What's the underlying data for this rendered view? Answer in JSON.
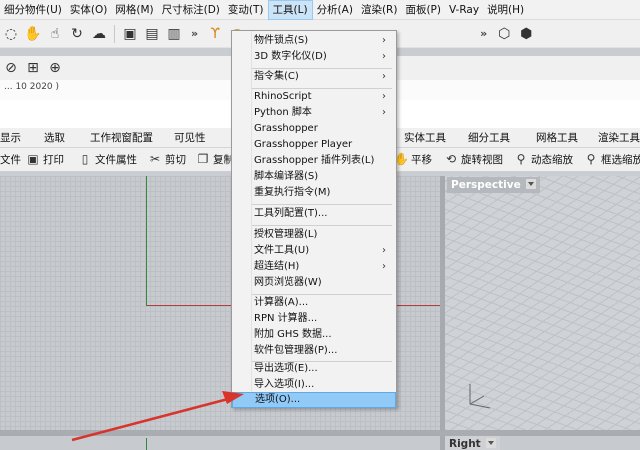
{
  "menubar": {
    "items": [
      "细分物件(U)",
      "实体(O)",
      "网格(M)",
      "尺寸标注(D)",
      "变动(T)",
      "工具(L)",
      "分析(A)",
      "渲染(R)",
      "面板(P)",
      "V-Ray",
      "说明(H)"
    ],
    "active": "工具(L)"
  },
  "command_line": "... 10 2020 )",
  "tabs": [
    "显示",
    "选取",
    "工作视窗配置",
    "可见性",
    "实体工具",
    "细分工具",
    "网格工具",
    "渲染工具"
  ],
  "std_toolbar": {
    "file": "文件",
    "print": "打印",
    "properties": "文件属性",
    "cut": "剪切",
    "copy": "复制",
    "pan": "平移",
    "rotate_view": "旋转视图",
    "dynamic_zoom": "动态缩放",
    "zoom_window": "框选缩放"
  },
  "viewports": {
    "perspective": "Perspective",
    "right": "Right"
  },
  "tools_menu": {
    "groups": [
      [
        {
          "label": "物件锁点(S)",
          "submenu": true
        },
        {
          "label": "3D 数字化仪(D)",
          "submenu": true
        }
      ],
      [
        {
          "label": "指令集(C)",
          "submenu": true
        }
      ],
      [
        {
          "label": "RhinoScript",
          "submenu": true
        },
        {
          "label": "Python 脚本",
          "submenu": true
        },
        {
          "label": "Grasshopper",
          "submenu": false
        },
        {
          "label": "Grasshopper Player",
          "submenu": false
        },
        {
          "label": "Grasshopper 插件列表(L)",
          "submenu": false
        },
        {
          "label": "脚本编译器(S)",
          "submenu": false
        },
        {
          "label": "重复执行指令(M)",
          "submenu": false
        }
      ],
      [
        {
          "label": "工具列配置(T)...",
          "submenu": false
        }
      ],
      [
        {
          "label": "授权管理器(L)",
          "submenu": false
        },
        {
          "label": "文件工具(U)",
          "submenu": true
        },
        {
          "label": "超连结(H)",
          "submenu": true
        },
        {
          "label": "网页浏览器(W)",
          "submenu": false
        }
      ],
      [
        {
          "label": "计算器(A)...",
          "submenu": false
        },
        {
          "label": "RPN 计算器...",
          "submenu": false
        },
        {
          "label": "附加 GHS 数据...",
          "submenu": false
        },
        {
          "label": "软件包管理器(P)...",
          "submenu": false
        }
      ],
      [
        {
          "label": "导出选项(E)...",
          "submenu": false
        },
        {
          "label": "导入选项(I)...",
          "submenu": false
        },
        {
          "label": "选项(O)...",
          "submenu": false,
          "highlighted": true
        }
      ]
    ]
  },
  "colors": {
    "highlight": "#91c9f7",
    "annotation_arrow": "#d9342b",
    "x_axis": "#b63b3b",
    "y_axis": "#2f8a3a"
  }
}
